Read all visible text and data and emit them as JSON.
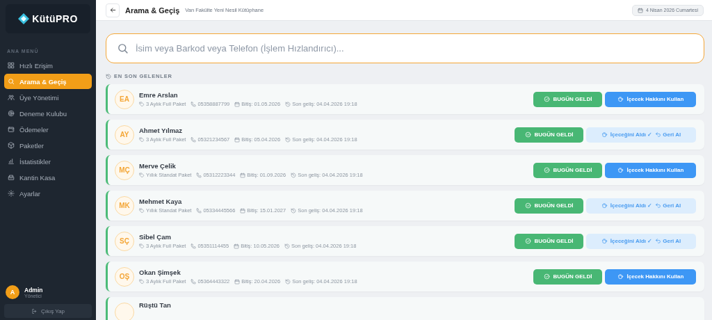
{
  "sidebar": {
    "logo": "KütüPRO",
    "section_label": "ANA MENÜ",
    "items": [
      {
        "label": "Hızlı Erişim",
        "selected": false
      },
      {
        "label": "Arama & Geçiş",
        "selected": true
      },
      {
        "label": "Üye Yönetimi",
        "selected": false
      },
      {
        "label": "Deneme Kulubu",
        "selected": false
      },
      {
        "label": "Ödemeler",
        "selected": false
      },
      {
        "label": "Paketler",
        "selected": false
      },
      {
        "label": "İstatistikler",
        "selected": false
      },
      {
        "label": "Kantin Kasa",
        "selected": false
      },
      {
        "label": "Ayarlar",
        "selected": false
      }
    ],
    "user": {
      "initial": "A",
      "name": "Admin",
      "role": "Yönetici"
    },
    "logout": "Çıkış Yap"
  },
  "header": {
    "title": "Arama & Geçiş",
    "subtitle": "Van Fakülte Yeni Nesil Kütüphane",
    "date": "4 Nisan 2026 Cumartesi"
  },
  "search": {
    "placeholder": "İsim veya Barkod veya Telefon (İşlem Hızlandırıcı)..."
  },
  "recent": {
    "label": "EN SON GELENLER",
    "rows": [
      {
        "initials": "EA",
        "name": "Emre Arslan",
        "package": "3 Aylık Full Paket",
        "phone": "05358887799",
        "end": "Bitiş: 01.05.2026",
        "last": "Son geliş: 04.04.2026 19:18",
        "arrived": "BUGÜN GELDİ",
        "drink_taken": false,
        "drink": "İçecek Hakkını Kullan"
      },
      {
        "initials": "AY",
        "name": "Ahmet Yılmaz",
        "package": "3 Aylık Full Paket",
        "phone": "05321234567",
        "end": "Bitiş: 05.04.2026",
        "last": "Son geliş: 04.04.2026 19:18",
        "arrived": "BUGÜN GELDİ",
        "drink_taken": true,
        "drink": "İçeceğini Aldı ✓",
        "undo": "Geri Al"
      },
      {
        "initials": "MÇ",
        "name": "Merve Çelik",
        "package": "Yıllık Standat Paket",
        "phone": "05312223344",
        "end": "Bitiş: 01.09.2026",
        "last": "Son geliş: 04.04.2026 19:18",
        "arrived": "BUGÜN GELDİ",
        "drink_taken": false,
        "drink": "İçecek Hakkını Kullan"
      },
      {
        "initials": "MK",
        "name": "Mehmet Kaya",
        "package": "Yıllık Standat Paket",
        "phone": "05334445566",
        "end": "Bitiş: 15.01.2027",
        "last": "Son geliş: 04.04.2026 19:18",
        "arrived": "BUGÜN GELDİ",
        "drink_taken": true,
        "drink": "İçeceğini Aldı ✓",
        "undo": "Geri Al"
      },
      {
        "initials": "SÇ",
        "name": "Sibel Çam",
        "package": "3 Aylık Full Paket",
        "phone": "05351114455",
        "end": "Bitiş: 10.05.2026",
        "last": "Son geliş: 04.04.2026 19:18",
        "arrived": "BUGÜN GELDİ",
        "drink_taken": true,
        "drink": "İçeceğini Aldı ✓",
        "undo": "Geri Al"
      },
      {
        "initials": "OŞ",
        "name": "Okan Şimşek",
        "package": "3 Aylık Full Paket",
        "phone": "05364443322",
        "end": "Bitiş: 20.04.2026",
        "last": "Son geliş: 04.04.2026 19:18",
        "arrived": "BUGÜN GELDİ",
        "drink_taken": false,
        "drink": "İçecek Hakkını Kullan"
      },
      {
        "name": "Rüştü Tan"
      }
    ]
  }
}
